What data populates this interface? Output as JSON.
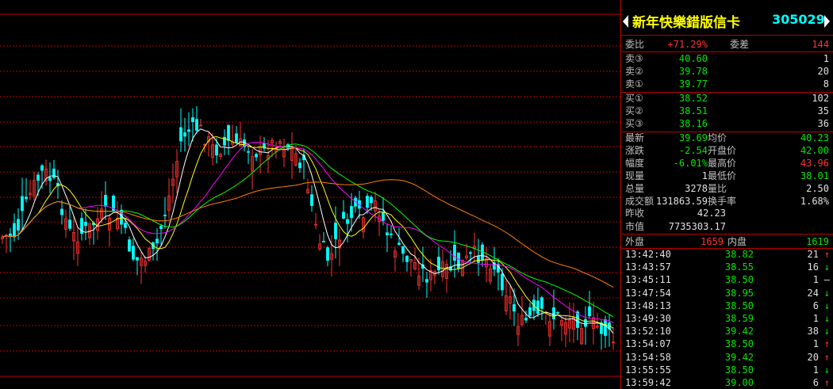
{
  "stock": {
    "name": "新年快樂錯版信卡",
    "code": "305029"
  },
  "ratio": {
    "weibi_label": "委比",
    "weibi_value": "+71.29%",
    "weicha_label": "委差",
    "weicha_value": "144"
  },
  "sells": [
    {
      "label": "卖③",
      "price": "40.60",
      "vol": "1"
    },
    {
      "label": "卖②",
      "price": "39.78",
      "vol": "20"
    },
    {
      "label": "卖①",
      "price": "39.77",
      "vol": "8"
    }
  ],
  "buys": [
    {
      "label": "买①",
      "price": "38.52",
      "vol": "102"
    },
    {
      "label": "买②",
      "price": "38.51",
      "vol": "35"
    },
    {
      "label": "买③",
      "price": "38.16",
      "vol": "36"
    }
  ],
  "stats": [
    {
      "l1": "最新",
      "v1": "39.69",
      "c1": "green",
      "l2": "均价",
      "v2": "40.23",
      "c2": "green"
    },
    {
      "l1": "涨跌",
      "v1": "-2.54",
      "c1": "green",
      "l2": "开盘价",
      "v2": "42.00",
      "c2": "green"
    },
    {
      "l1": "幅度",
      "v1": "-6.01%",
      "c1": "green",
      "l2": "最高价",
      "v2": "43.96",
      "c2": "red"
    },
    {
      "l1": "现量",
      "v1": "1",
      "c1": "white",
      "l2": "最低价",
      "v2": "38.01",
      "c2": "green"
    },
    {
      "l1": "总量",
      "v1": "3278",
      "c1": "white",
      "l2": "量比",
      "v2": "2.50",
      "c2": "white"
    },
    {
      "l1": "成交额",
      "v1": "131863.59",
      "c1": "white",
      "l2": "换手率",
      "v2": "1.68%",
      "c2": "white"
    }
  ],
  "prev_close": {
    "label": "昨收",
    "value": "42.23"
  },
  "market_value": {
    "label": "市值",
    "value": "7735303.17"
  },
  "outer_inner": {
    "outer_label": "外盘",
    "outer_value": "1659",
    "inner_label": "内盘",
    "inner_value": "1619"
  },
  "ticks": [
    {
      "time": "13:42:40",
      "price": "38.82",
      "vol": "21",
      "dir": "↑"
    },
    {
      "time": "13:43:57",
      "price": "38.55",
      "vol": "16",
      "dir": "↓"
    },
    {
      "time": "13:45:11",
      "price": "38.50",
      "vol": "1",
      "dir": "—"
    },
    {
      "time": "13:47:54",
      "price": "38.95",
      "vol": "24",
      "dir": "↓"
    },
    {
      "time": "13:48:13",
      "price": "38.50",
      "vol": "6",
      "dir": "↓"
    },
    {
      "time": "13:49:30",
      "price": "38.59",
      "vol": "1",
      "dir": "↓"
    },
    {
      "time": "13:52:10",
      "price": "39.42",
      "vol": "38",
      "dir": "↓"
    },
    {
      "time": "13:54:07",
      "price": "38.50",
      "vol": "1",
      "dir": "↑"
    },
    {
      "time": "13:54:58",
      "price": "39.42",
      "vol": "20",
      "dir": "↑"
    },
    {
      "time": "13:55:55",
      "price": "38.50",
      "vol": "1",
      "dir": "↓"
    },
    {
      "time": "13:59:42",
      "price": "39.00",
      "vol": "6",
      "dir": "↑"
    }
  ],
  "colors": {
    "up": "#ff3232",
    "down": "#00ffff",
    "ma5": "#ffffff",
    "ma10": "#ffff00",
    "ma20": "#ff00ff",
    "ma30": "#00ff00",
    "ma60": "#ff8000",
    "grid": "#c00000"
  }
}
